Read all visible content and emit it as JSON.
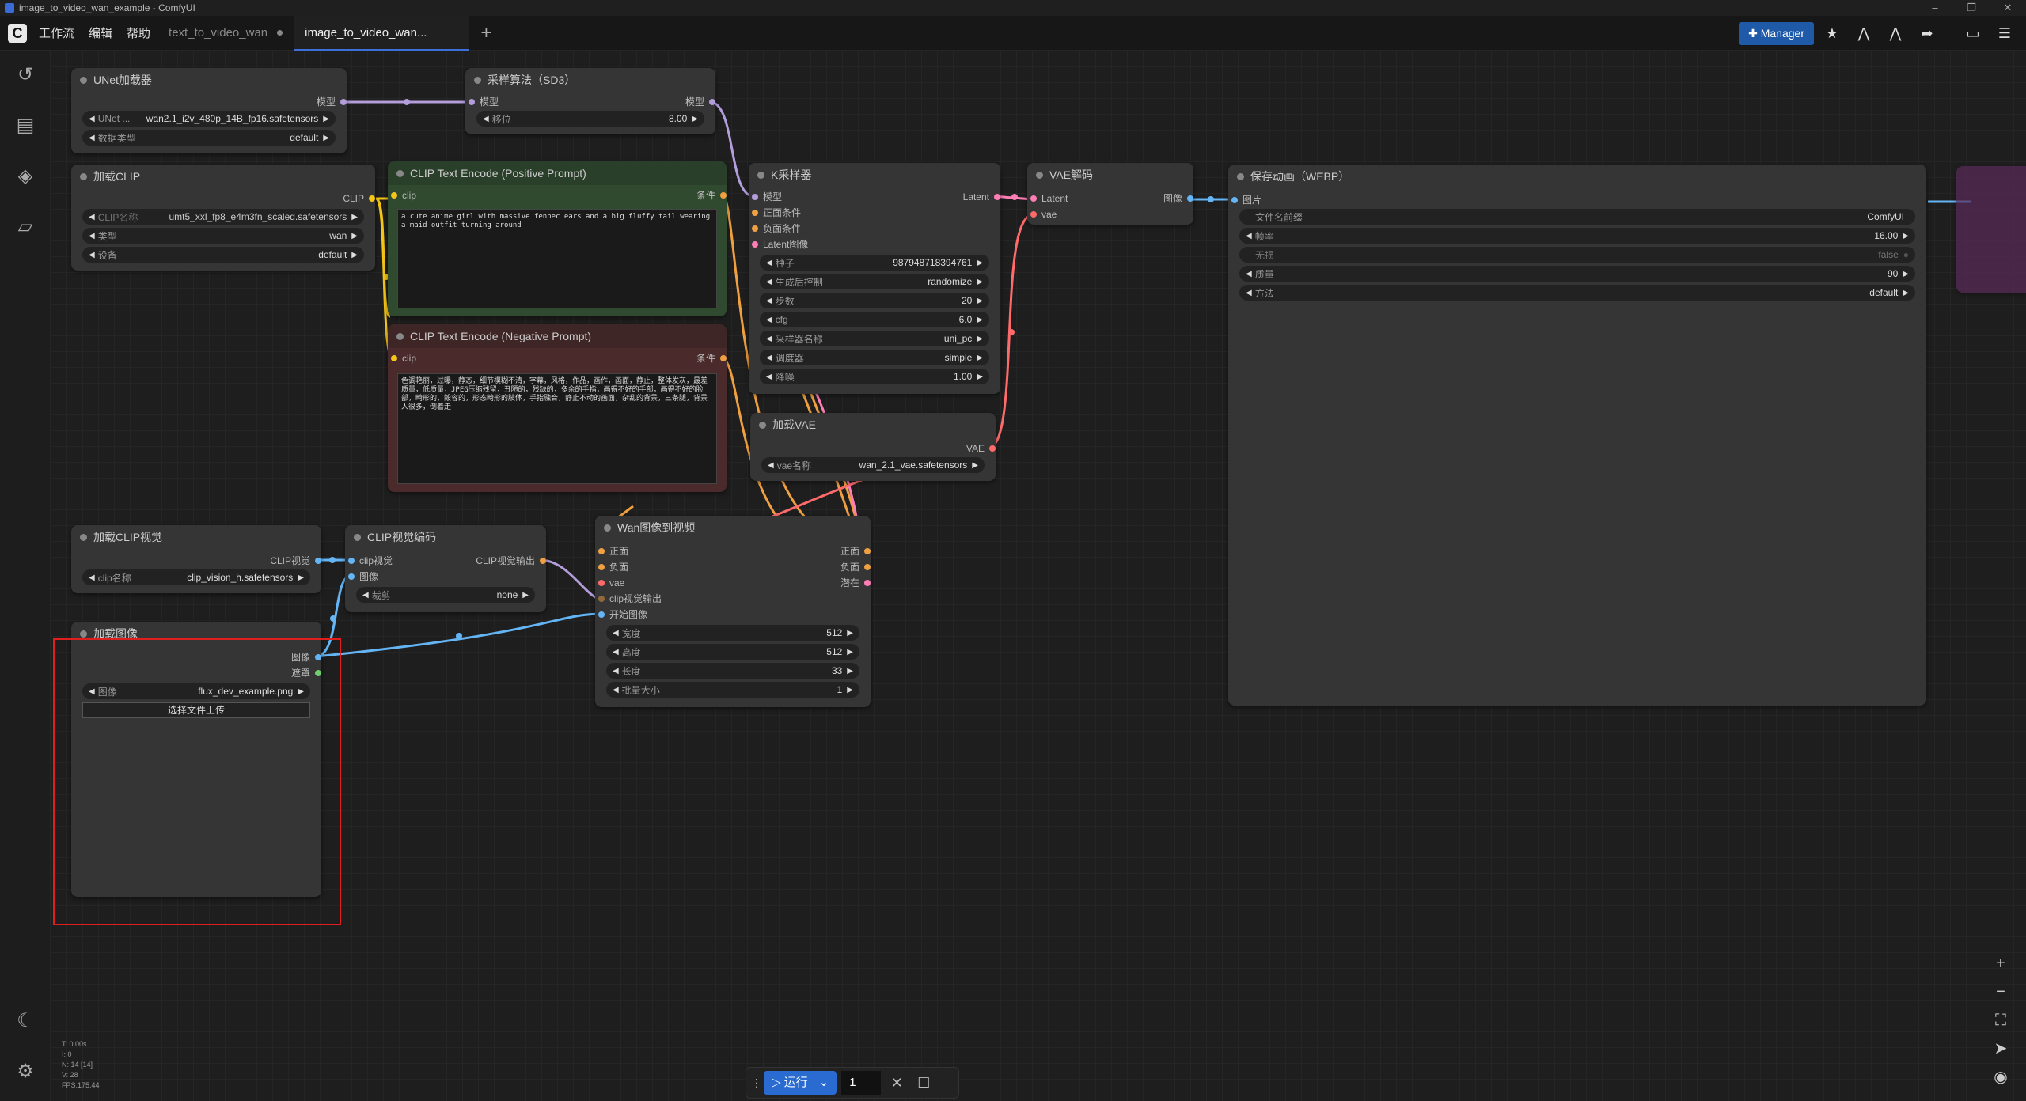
{
  "titlebar": {
    "title": "image_to_video_wan_example - ComfyUI",
    "min": "–",
    "max": "❐",
    "close": "✕"
  },
  "menu": {
    "logo": "C",
    "items": [
      "工作流",
      "编辑",
      "帮助"
    ]
  },
  "tabs": [
    {
      "label": "text_to_video_wan",
      "active": false
    },
    {
      "label": "image_to_video_wan...",
      "active": true
    }
  ],
  "tab_add": "+",
  "toolbar": {
    "manager_label": "Manager"
  },
  "nodes": {
    "unet": {
      "title": "UNet加载器",
      "output": "模型",
      "w_unet_label": "UNet ...",
      "w_unet_value": "wan2.1_i2v_480p_14B_fp16.safetensors",
      "w_dtype_label": "数据类型",
      "w_dtype_value": "default"
    },
    "sampling": {
      "title": "采样算法（SD3）",
      "input": "模型",
      "output": "模型",
      "w_shift_label": "移位",
      "w_shift_value": "8.00"
    },
    "clip_loader": {
      "title": "加载CLIP",
      "output": "CLIP",
      "w_name_label": "CLIP名称",
      "w_name_value": "umt5_xxl_fp8_e4m3fn_scaled.safetensors",
      "w_type_label": "类型",
      "w_type_value": "wan",
      "w_device_label": "设备",
      "w_device_value": "default"
    },
    "pos_prompt": {
      "title": "CLIP Text Encode (Positive Prompt)",
      "input": "clip",
      "output": "条件",
      "text": "a cute anime girl with massive fennec ears and a big fluffy tail wearing a maid outfit turning around"
    },
    "neg_prompt": {
      "title": "CLIP Text Encode (Negative Prompt)",
      "input": "clip",
      "output": "条件",
      "text": "色调艳丽，过曝，静态，细节模糊不清，字幕，风格，作品，画作，画面，静止，整体发灰，最差质量，低质量，JPEG压缩残留，丑陋的，残缺的，多余的手指，画得不好的手部，画得不好的脸部，畸形的，毁容的，形态畸形的肢体，手指融合，静止不动的画面，杂乱的背景，三条腿，背景人很多，倒着走"
    },
    "ksampler": {
      "title": "K采样器",
      "inputs": [
        "模型",
        "正面条件",
        "负面条件",
        "Latent图像"
      ],
      "output": "Latent",
      "widgets": [
        {
          "label": "种子",
          "value": "987948718394761"
        },
        {
          "label": "生成后控制",
          "value": "randomize"
        },
        {
          "label": "步数",
          "value": "20"
        },
        {
          "label": "cfg",
          "value": "6.0"
        },
        {
          "label": "采样器名称",
          "value": "uni_pc"
        },
        {
          "label": "调度器",
          "value": "simple"
        },
        {
          "label": "降噪",
          "value": "1.00"
        }
      ]
    },
    "vae_decode": {
      "title": "VAE解码",
      "inputs": [
        "Latent",
        "vae"
      ],
      "output": "图像"
    },
    "save": {
      "title": "保存动画（WEBP）",
      "input": "图片",
      "widgets": [
        {
          "label": "文件名前缀",
          "value": "ComfyUI"
        },
        {
          "label": "帧率",
          "value": "16.00"
        },
        {
          "label": "无损",
          "value": "false"
        },
        {
          "label": "质量",
          "value": "90"
        },
        {
          "label": "方法",
          "value": "default"
        }
      ]
    },
    "vae_loader": {
      "title": "加载VAE",
      "output": "VAE",
      "w_name_label": "vae名称",
      "w_name_value": "wan_2.1_vae.safetensors"
    },
    "clip_vision_loader": {
      "title": "加载CLIP视觉",
      "output": "CLIP视觉",
      "w_name_label": "clip名称",
      "w_name_value": "clip_vision_h.safetensors"
    },
    "clip_vision_encode": {
      "title": "CLIP视觉编码",
      "inputs": [
        "clip视觉",
        "图像"
      ],
      "output": "CLIP视觉输出",
      "w_crop_label": "裁剪",
      "w_crop_value": "none"
    },
    "wan_i2v": {
      "title": "Wan图像到视频",
      "inputs": [
        "正面",
        "负面",
        "vae",
        "clip视觉输出",
        "开始图像"
      ],
      "outputs": [
        "正面",
        "负面",
        "潜在"
      ],
      "widgets": [
        {
          "label": "宽度",
          "value": "512"
        },
        {
          "label": "高度",
          "value": "512"
        },
        {
          "label": "长度",
          "value": "33"
        },
        {
          "label": "批量大小",
          "value": "1"
        }
      ]
    },
    "load_image": {
      "title": "加载图像",
      "outputs": [
        "图像",
        "遮罩"
      ],
      "w_image_label": "图像",
      "w_image_value": "flux_dev_example.png",
      "upload_label": "选择文件上传"
    }
  },
  "bottom_bar": {
    "run_label": "运行",
    "count": "1"
  },
  "stats": [
    "T: 0.00s",
    "I: 0",
    "N: 14 [14]",
    "V: 28",
    "FPS:175.44"
  ],
  "colors": {
    "accent": "#2a6bd1",
    "positive_node": "#2f4a2f",
    "negative_node": "#4a2a2a",
    "model_wire": "#b39ddb",
    "clip_wire": "#f5c518",
    "latent_wire": "#ff7eb6",
    "vae_wire": "#ff6b6b",
    "image_wire": "#64b5f6",
    "conditioning_wire": "#f0a040",
    "selection": "#e01e1e"
  }
}
